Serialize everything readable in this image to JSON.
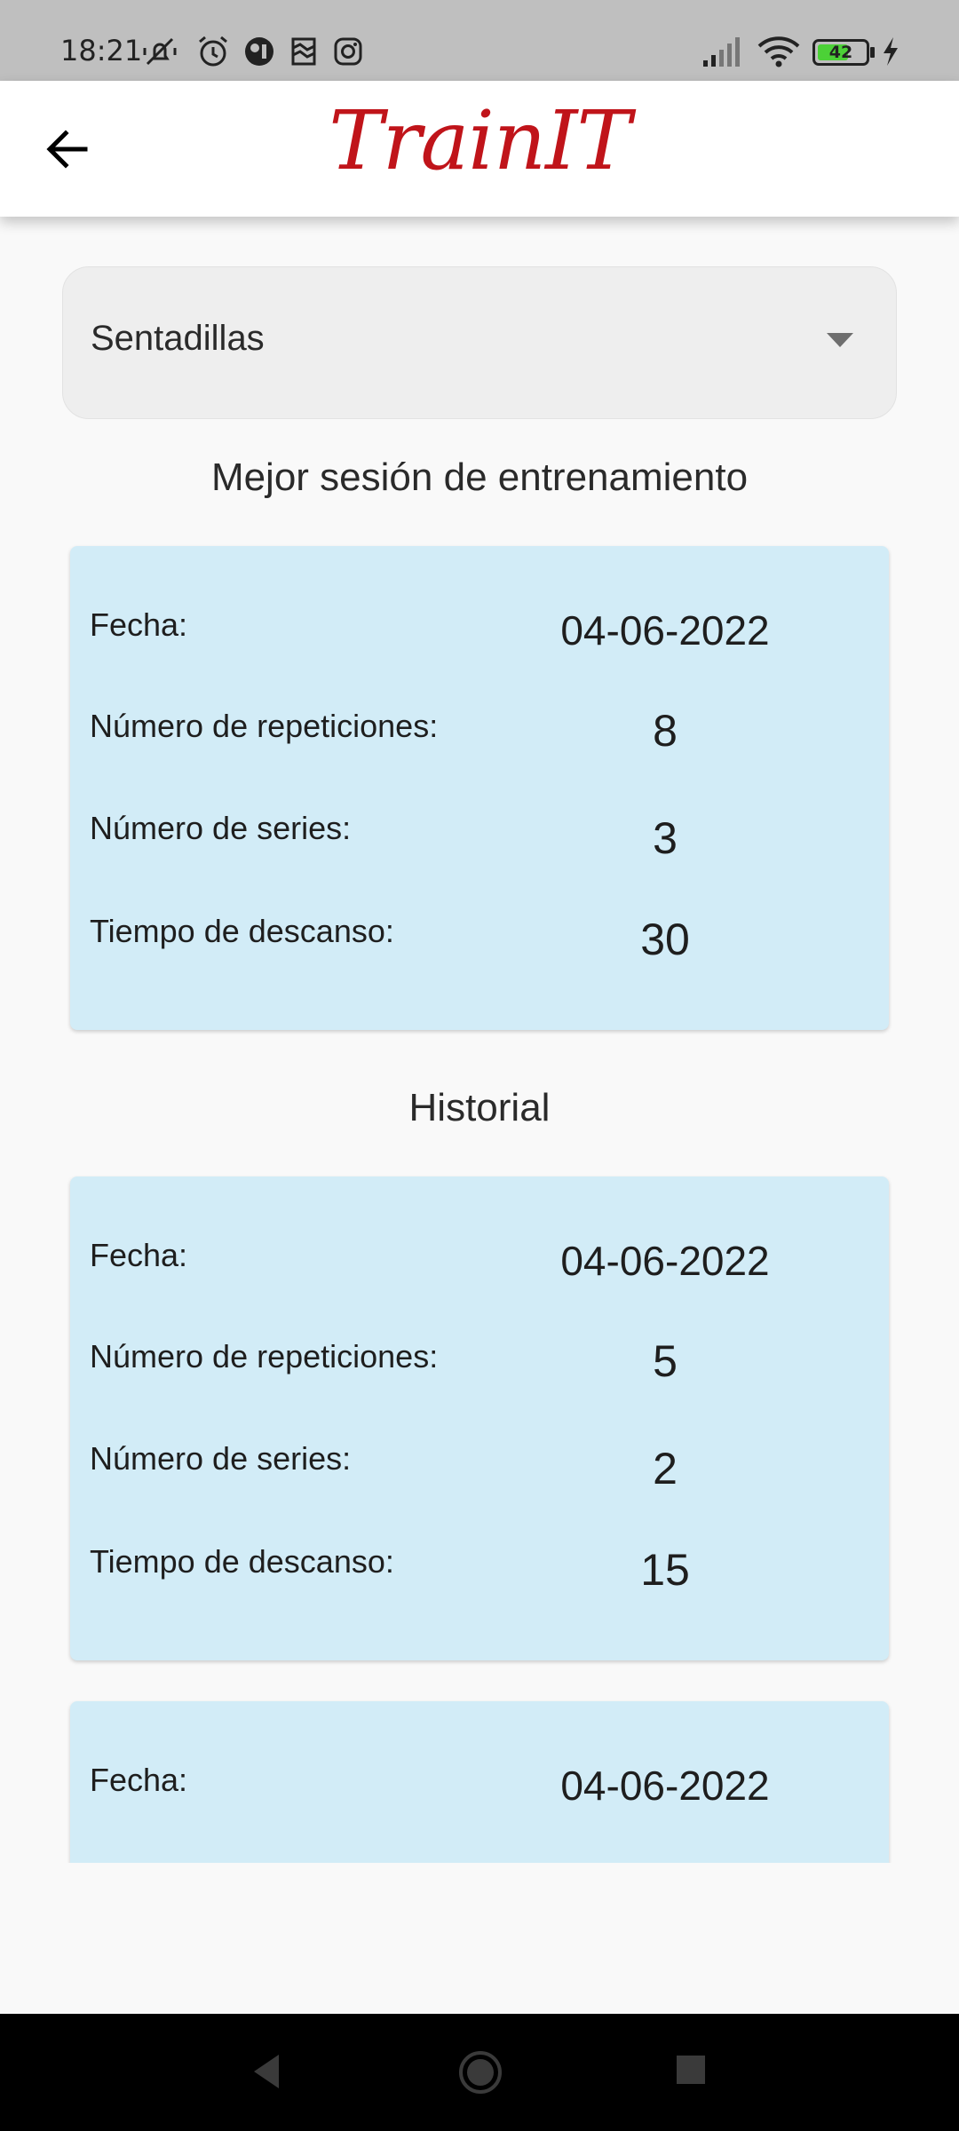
{
  "status_bar": {
    "time": "18:21",
    "battery_level": "42",
    "icons": [
      "muted-vibrate-icon",
      "alarm-icon",
      "app-icon",
      "photo-icon",
      "instagram-icon",
      "signal-icon",
      "wifi-icon",
      "battery-icon",
      "charging-icon"
    ]
  },
  "app_bar": {
    "title": "TrainIT",
    "title_color": "#c0141a"
  },
  "exercise_select": {
    "value": "Sentadillas"
  },
  "best_session": {
    "heading": "Mejor sesión de entrenamiento",
    "rows": [
      {
        "label": "Fecha:",
        "value": "04-06-2022"
      },
      {
        "label": "Número de repeticiones:",
        "value": "8"
      },
      {
        "label": "Número de series:",
        "value": "3"
      },
      {
        "label": "Tiempo de descanso:",
        "value": "30"
      }
    ]
  },
  "history": {
    "heading": "Historial",
    "entries": [
      {
        "rows": [
          {
            "label": "Fecha:",
            "value": "04-06-2022"
          },
          {
            "label": "Número de repeticiones:",
            "value": "5"
          },
          {
            "label": "Número de series:",
            "value": "2"
          },
          {
            "label": "Tiempo de descanso:",
            "value": "15"
          }
        ]
      },
      {
        "rows": [
          {
            "label": "Fecha:",
            "value": "04-06-2022"
          }
        ]
      }
    ]
  },
  "colors": {
    "card_background": "#d2ecf7",
    "page_background": "#f9f9f9",
    "status_bar": "#bfbfbf"
  }
}
